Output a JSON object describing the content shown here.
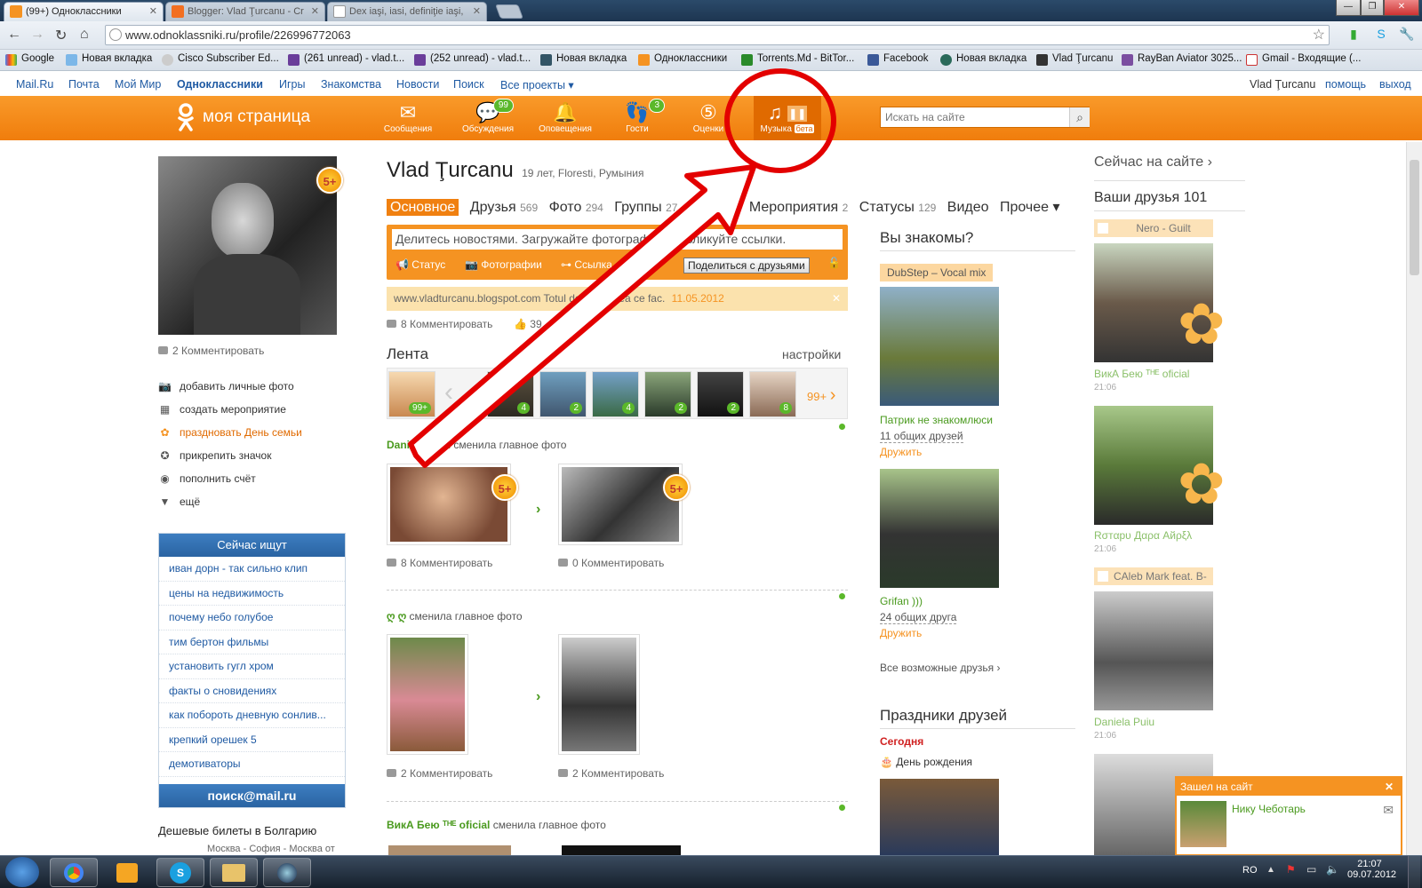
{
  "browser": {
    "tabs": [
      {
        "label": "(99+) Одноклассники",
        "active": true
      },
      {
        "label": "Blogger: Vlad Ţurcanu - Cr",
        "active": false
      },
      {
        "label": "Dex iaşi, iasi, definiţie iaşi,",
        "active": false
      }
    ],
    "url": "www.odnoklassniki.ru/profile/226996772063",
    "bookmarks": [
      "Google",
      "Новая вкладка",
      "Cisco Subscriber Ed...",
      "(261 unread) - vlad.t...",
      "(252 unread) - vlad.t...",
      "Новая вкладка",
      "Одноклассники",
      "Torrents.Md - BitTor...",
      "Facebook",
      "Новая вкладка",
      "Vlad Ţurcanu",
      "RayBan Aviator 3025...",
      "Gmail - Входящие (..."
    ]
  },
  "mailbar": {
    "links": [
      "Mail.Ru",
      "Почта",
      "Мой Мир",
      "Одноклассники",
      "Игры",
      "Знакомства",
      "Новости",
      "Поиск",
      "Все проекты ▾"
    ],
    "user": "Vlad Ţurcanu",
    "help": "помощь",
    "logout": "выход"
  },
  "topbar": {
    "logo": "моя страница",
    "nav": [
      {
        "label": "Сообщения",
        "icon": "envelope-icon",
        "badge": ""
      },
      {
        "label": "Обсуждения",
        "icon": "chat-icon",
        "badge": "99"
      },
      {
        "label": "Оповещения",
        "icon": "bell-icon",
        "badge": ""
      },
      {
        "label": "Гости",
        "icon": "footprints-icon",
        "badge": "3"
      },
      {
        "label": "Оценки",
        "icon": "rating-icon",
        "badge": ""
      }
    ],
    "music": {
      "label": "Музыка",
      "beta": "бета"
    },
    "search_placeholder": "Искать на сайте"
  },
  "left": {
    "comments": "2 Комментировать",
    "menu": [
      "добавить личные фото",
      "создать мероприятие",
      "праздновать День семьи",
      "прикрепить значок",
      "пополнить счёт",
      "ещё"
    ],
    "now_searching": {
      "title": "Сейчас ищут",
      "queries": [
        "иван дорн - так сильно клип",
        "цены на недвижимость",
        "почему небо голубое",
        "тим бертон фильмы",
        "установить гугл хром",
        "факты о сновидениях",
        "как побороть дневную сонлив...",
        "крепкий орешек 5",
        "демотиваторы"
      ],
      "footer": "поиск@mail.ru"
    },
    "ad_title": "Дешевые билеты в Болгарию",
    "ad_sub": "Москва - София - Москва от"
  },
  "profile": {
    "name": "Vlad Ţurcanu",
    "info": "19 лет, Floresti, Румыния",
    "tabs": [
      {
        "label": "Основное",
        "count": ""
      },
      {
        "label": "Друзья",
        "count": "569"
      },
      {
        "label": "Фото",
        "count": "294"
      },
      {
        "label": "Группы",
        "count": "27"
      },
      {
        "label": "Игры",
        "count": "51"
      },
      {
        "label": "Мероприятия",
        "count": "2"
      },
      {
        "label": "Статусы",
        "count": "129"
      },
      {
        "label": "Видео",
        "count": ""
      },
      {
        "label": "Прочее ▾",
        "count": ""
      }
    ],
    "status_placeholder": "Делитесь новостями. Загружайте фотографии. Публикуйте ссылки.",
    "status_actions": [
      "Статус",
      "Фотографии",
      "Ссылка"
    ],
    "share_button": "Поделиться с друзьями",
    "link_post": {
      "url": "www.vladturcanu.blogspot.com",
      "text": "Totul despre ideea ce fac.",
      "date": "11.05.2012"
    },
    "link_comments": "8 Комментировать",
    "link_likes": "39"
  },
  "feed": {
    "title": "Лента",
    "settings": "настройки",
    "thumbs": [
      "99+",
      "4",
      "2",
      "4",
      "2",
      "2",
      "8"
    ],
    "more": "99+",
    "events": [
      {
        "user": "Daniela Puiu",
        "action": "сменила главное фото",
        "c1": "8 Комментировать",
        "c2": "0 Комментировать"
      },
      {
        "user": "ღ ღ",
        "action": "сменила главное фото",
        "c1": "2 Комментировать",
        "c2": "2 Комментировать"
      },
      {
        "user": "ВикА Бею ᵀᴴᴱ oficial",
        "action": "сменила главное фото"
      }
    ]
  },
  "know": {
    "title": "Вы знакомы?",
    "music": "DubStep – Vocal mix",
    "people": [
      {
        "name": "Патрик не знакомлюси",
        "common": "11 общих друзей",
        "action": "Дружить"
      },
      {
        "name": "Grifan )))",
        "common": "24 общих друга",
        "action": "Дружить"
      }
    ],
    "all": "Все возможные друзья ›"
  },
  "holidays": {
    "title": "Праздники друзей",
    "today": "Сегодня",
    "event": "День рождения"
  },
  "online": {
    "title": "Сейчас на сайте ›",
    "friends_title": "Ваши друзья 101",
    "items": [
      {
        "music": "Nero - Guilt",
        "name": "ВикА Бею ᵀᴴᴱ oficial",
        "time": "21:06"
      },
      {
        "music": "",
        "name": "Rσтαрυ Дαρα Aйρξλ",
        "time": "21:06"
      },
      {
        "music": "CAleb Mark feat. B-",
        "name": "Daniela Puiu",
        "time": "21:06"
      }
    ]
  },
  "popup": {
    "title": "Зашел на сайт",
    "name": "Нику Чеботарь"
  },
  "taskbar": {
    "lang": "RO",
    "time": "21:07",
    "date": "09.07.2012"
  },
  "colors": {
    "brand": "#f59322",
    "link": "#1f5aa3",
    "green": "#4a9a1e",
    "annotation": "#e30000"
  }
}
